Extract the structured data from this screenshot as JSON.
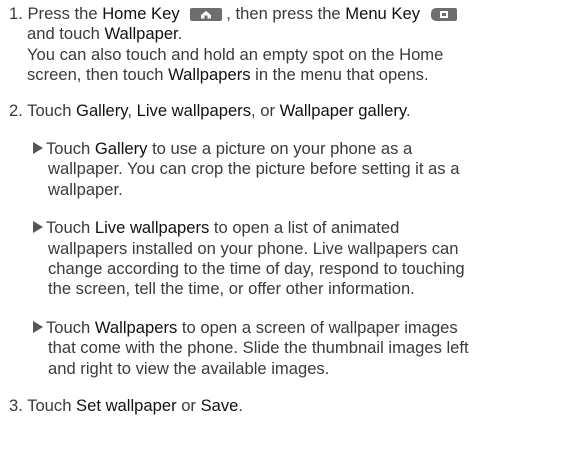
{
  "step1": {
    "number": "1.",
    "line1_a": "Press the ",
    "home_key": "Home Key",
    "line1_b": ", then press the ",
    "menu_key": "Menu Key",
    "line2_a": "and touch ",
    "wallpaper": "Wallpaper",
    "line2_b": ".",
    "line3": "You can also touch and hold an empty spot on the Home",
    "line4_a": "screen, then touch ",
    "wallpapers": "Wallpapers",
    "line4_b": " in the menu that opens."
  },
  "step2": {
    "number": "2.",
    "a": "Touch ",
    "gallery": "Gallery",
    "sep1": ", ",
    "live_wallpapers": "Live wallpapers",
    "sep2": ", or ",
    "wallpaper_gallery": "Wallpaper gallery",
    "end": "."
  },
  "bullet1": {
    "a": "Touch ",
    "gallery": "Gallery",
    "b": " to use a picture on your phone as a",
    "line2": "wallpaper. You can crop the picture before setting it as a",
    "line3": "wallpaper."
  },
  "bullet2": {
    "a": "Touch ",
    "live_wallpapers": "Live wallpapers",
    "b": " to open a list of animated",
    "line2": "wallpapers installed on your phone. Live wallpapers can",
    "line3": "change according to the time of day, respond to touching",
    "line4": "the screen, tell the time, or offer other information."
  },
  "bullet3": {
    "a": "Touch ",
    "wallpapers": "Wallpapers",
    "b": " to open a screen of wallpaper images",
    "line2": "that come with the phone. Slide the thumbnail images left",
    "line3": "and right to view the available images."
  },
  "step3": {
    "number": "3.",
    "a": "Touch ",
    "set_wallpaper": "Set wallpaper",
    "or": " or ",
    "save": "Save",
    "end": "."
  },
  "icons": {
    "home_key_icon": "home-icon",
    "menu_key_icon": "menu-icon",
    "bullet_icon": "triangle-right"
  }
}
